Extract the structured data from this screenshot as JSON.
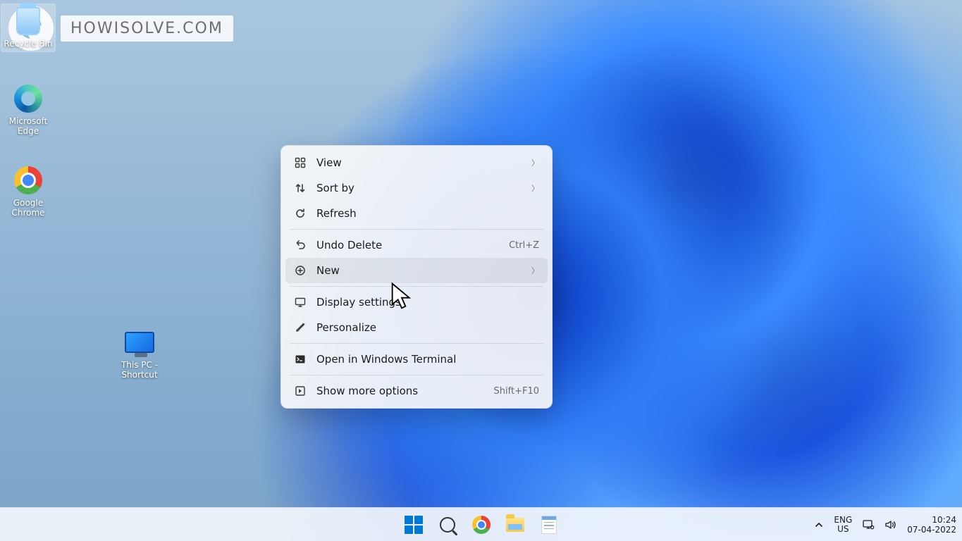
{
  "watermark": {
    "text": "HOWISOLVE.COM"
  },
  "desktop_icons": {
    "recycle_bin": "Recycle Bin",
    "edge": "Microsoft Edge",
    "chrome": "Google Chrome",
    "this_pc": "This PC - Shortcut"
  },
  "context_menu": {
    "view": "View",
    "sort_by": "Sort by",
    "refresh": "Refresh",
    "undo_delete": "Undo Delete",
    "undo_shortcut": "Ctrl+Z",
    "new": "New",
    "display": "Display settings",
    "personalize": "Personalize",
    "terminal": "Open in Windows Terminal",
    "more": "Show more options",
    "more_shortcut": "Shift+F10"
  },
  "taskbar": {
    "lang_top": "ENG",
    "lang_bottom": "US",
    "time": "10:24",
    "date": "07-04-2022"
  }
}
